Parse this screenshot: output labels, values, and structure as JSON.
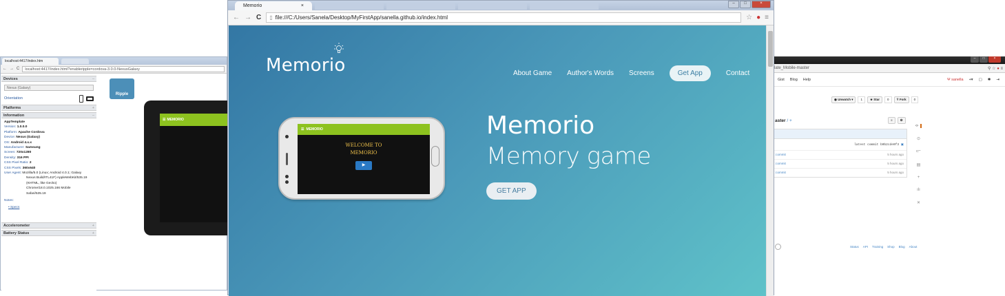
{
  "left_window": {
    "tab_title": "localhost:4417/index.htm",
    "url": "localhost:4417/index.html?enableripple=cordova-3.0.0-NexusGalaxy",
    "devices_label": "Devices",
    "device_select": "Nexus (Galaxy)",
    "orientation_label": "Orientation",
    "platforms_label": "Platforms",
    "information_label": "Information",
    "info": {
      "app": "AppTemplate",
      "version_k": "Version:",
      "version_v": "1.0.0.0",
      "platform_k": "Platform:",
      "platform_v": "Apache Cordova",
      "device_k": "Device:",
      "device_v": "Nexus (Galaxy)",
      "os_k": "OS:",
      "os_v": "Android 4.x.x",
      "manufacturer_k": "Manufacturer:",
      "manufacturer_v": "Samsung",
      "screen_k": "Screen:",
      "screen_v": "720x1280",
      "density_k": "Density:",
      "density_v": "316 PPI",
      "ratio_k": "CSS Pixel Ratio:",
      "ratio_v": "2",
      "csspx_k": "CSS Pixels:",
      "csspx_v": "360x640",
      "ua_k": "User Agent:",
      "ua_1": "Mozilla/5.0 (Linux; Android 4.0.1; Galaxy",
      "ua_2": "Nexus Build/ITL41F) AppleWebKit/535.19",
      "ua_3": "(KHTML, like Gecko)",
      "ua_4": "Chrome/18.0.1025.166 Mobile",
      "ua_5": "Safari/535.19"
    },
    "notes_label": "Notes:",
    "specs_link": "Specs",
    "accelerometer_label": "Accelerometer",
    "battery_label": "Battery Status",
    "ripple_logo": "Ripple",
    "tablet_brand": "MEMORIO"
  },
  "main_window": {
    "tab_title": "Memorio",
    "tab_close": "×",
    "url": "file:///C:/Users/Sanela/Desktop/MyFirstApp/sanella.github.io/index.html",
    "page": {
      "logo": "Memorio",
      "menu": [
        "About Game",
        "Author's Words",
        "Screens",
        "Get App",
        "Contact"
      ],
      "phone_brand": "MEMORIO",
      "phone_welcome_1": "WELCOME TO",
      "phone_welcome_2": "MEMORIO",
      "headline": "Memorio",
      "subheadline": "Memory game",
      "cta": "GET APP"
    }
  },
  "right_window": {
    "address_fragment": "late_Mobile-master",
    "nav": [
      "Gist",
      "Blog",
      "Help"
    ],
    "user": "sanella",
    "unwatch": "Unwatch",
    "unwatch_count": "1",
    "star": "Star",
    "star_count": "0",
    "fork": "Fork",
    "fork_count": "0",
    "branch": "aster",
    "branch_plus": "/ +",
    "latest_commit": "latest commit b0b2cde0f3",
    "rows": [
      {
        "name": ":commit",
        "time": "5 hours ago"
      },
      {
        "name": ":commit",
        "time": "5 hours ago"
      },
      {
        "name": ":commit",
        "time": "5 hours ago"
      }
    ],
    "footer_links": [
      "Status",
      "API",
      "Training",
      "Shop",
      "Blog",
      "About"
    ]
  },
  "colors": {
    "page_gradient_start": "#3377a4",
    "page_gradient_end": "#5fc2c9",
    "tablet_bar": "#8dc21f"
  }
}
